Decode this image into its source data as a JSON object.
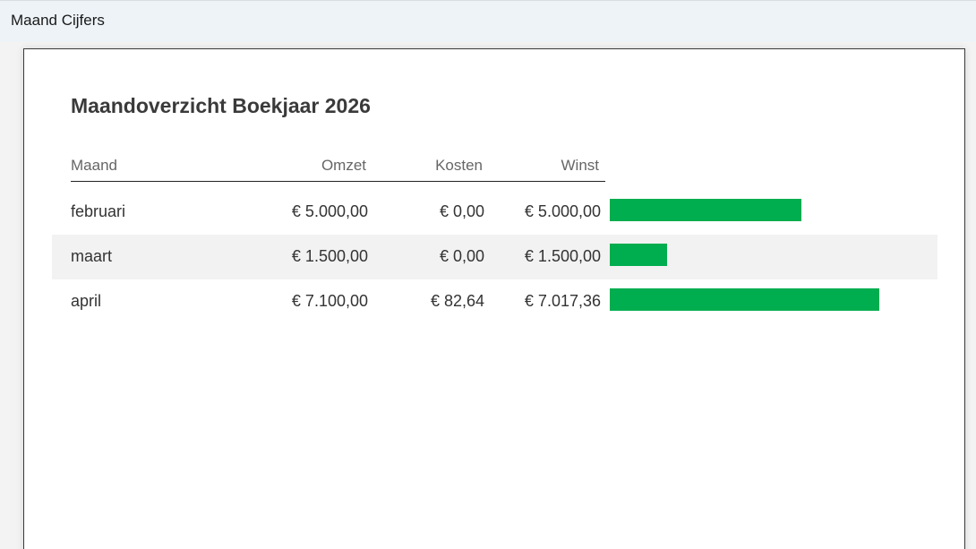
{
  "window": {
    "title": "Maand Cijfers"
  },
  "report": {
    "title": "Maandoverzicht Boekjaar 2026",
    "headers": {
      "month": "Maand",
      "revenue": "Omzet",
      "costs": "Kosten",
      "profit": "Winst"
    },
    "bar_color": "#00ad4f",
    "bar_scale_max": 7017.36,
    "rows": [
      {
        "month": "februari",
        "revenue": "€ 5.000,00",
        "costs": "€ 0,00",
        "profit": "€ 5.000,00",
        "profit_value": 5000.0
      },
      {
        "month": "maart",
        "revenue": "€ 1.500,00",
        "costs": "€ 0,00",
        "profit": "€ 1.500,00",
        "profit_value": 1500.0
      },
      {
        "month": "april",
        "revenue": "€ 7.100,00",
        "costs": "€ 82,64",
        "profit": "€ 7.017,36",
        "profit_value": 7017.36
      }
    ]
  }
}
